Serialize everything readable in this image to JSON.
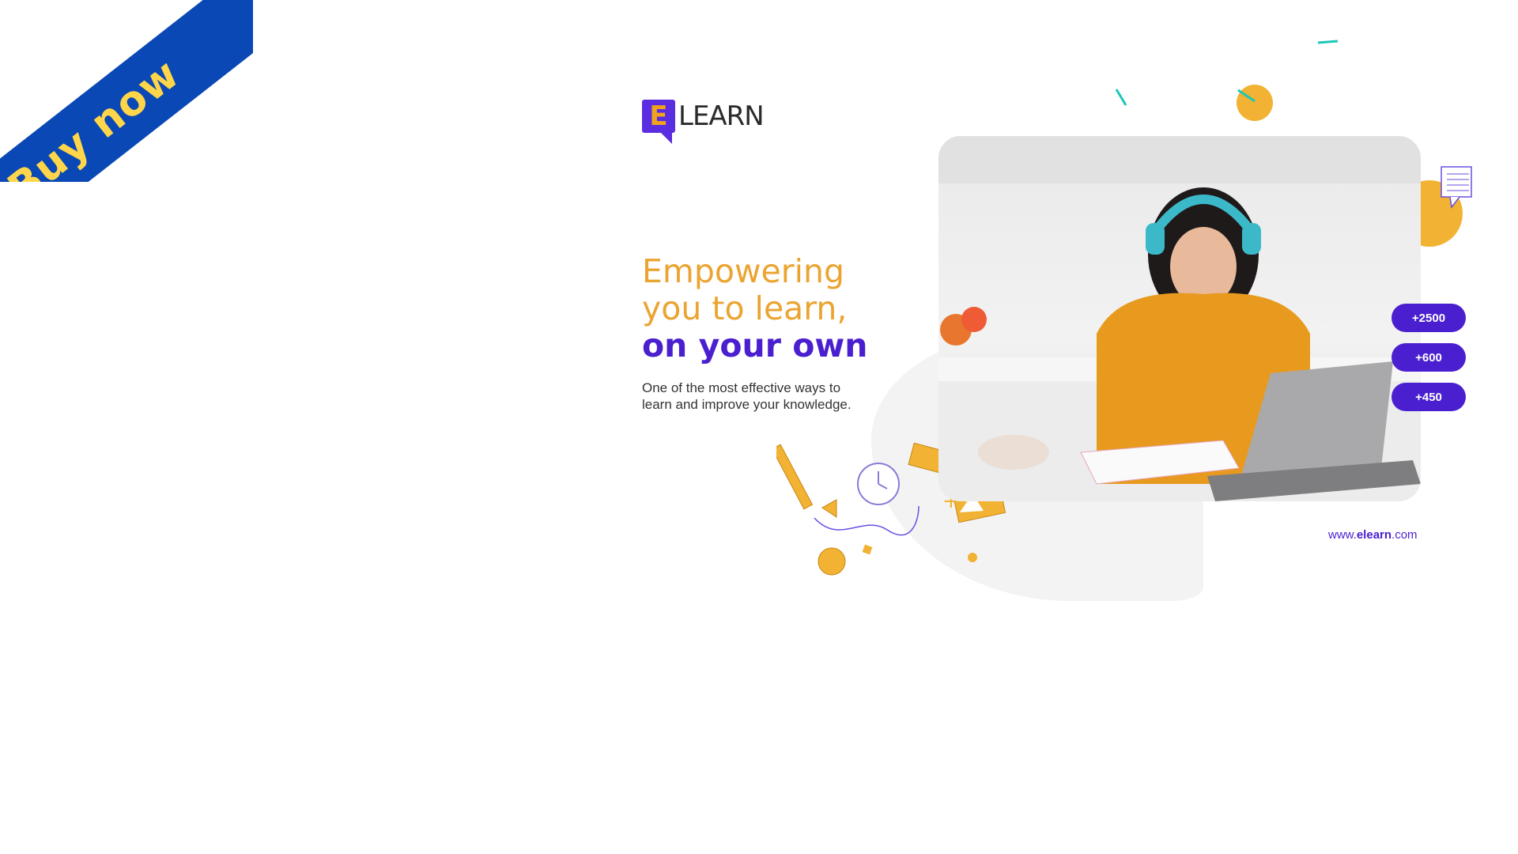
{
  "ribbon": {
    "label": "Buy now"
  },
  "logo": {
    "mark_letter": "E",
    "text": "LEARN"
  },
  "hero": {
    "line1": "Empowering",
    "line2": "you to learn,",
    "line3": "on your own",
    "subtext": "One of the most effective ways to learn and improve your knowledge."
  },
  "stats": [
    {
      "label": "+2500"
    },
    {
      "label": "+600"
    },
    {
      "label": "+450"
    }
  ],
  "footer": {
    "url_prefix": "www.",
    "url_brand": "elearn",
    "url_suffix": ".com"
  },
  "colors": {
    "brand_purple": "#4a1fcf",
    "brand_orange": "#eba431",
    "ribbon_blue": "#0a48b5",
    "ribbon_text": "#ffd64a"
  }
}
